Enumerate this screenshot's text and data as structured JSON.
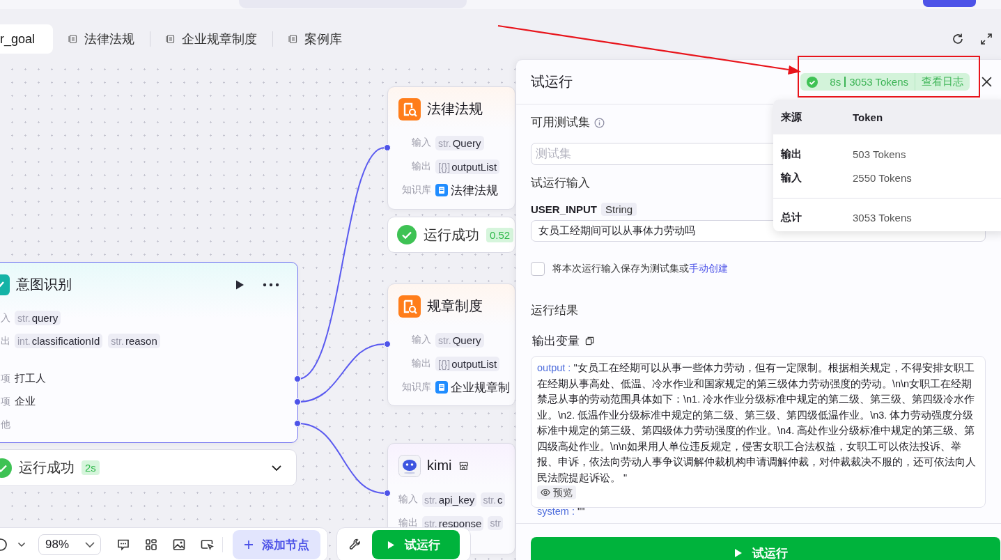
{
  "tabs": [
    {
      "label": "r_goal",
      "selected": true,
      "kind": "variable"
    },
    {
      "label": "法律法规",
      "selected": false,
      "kind": "doc"
    },
    {
      "label": "企业规章制度",
      "selected": false,
      "kind": "doc"
    },
    {
      "label": "案例库",
      "selected": false,
      "kind": "doc"
    }
  ],
  "canvas": {
    "nodes": [
      {
        "kind": "intent",
        "title": "意图识别",
        "rows": [
          {
            "label": "入",
            "chips": [
              {
                "type": "str.",
                "name": "query"
              }
            ]
          },
          {
            "label": "出",
            "chips": [
              {
                "type": "int.",
                "name": "classificationId"
              },
              {
                "type": "str.",
                "name": "reason"
              }
            ]
          }
        ],
        "options": [
          {
            "label": "项",
            "value": "打工人"
          },
          {
            "label": "项",
            "value": "企业"
          },
          {
            "label": "他"
          }
        ],
        "status": {
          "text": "运行成功",
          "time": "2s"
        }
      },
      {
        "kind": "knowledge",
        "title": "法律法规",
        "rows": [
          {
            "label": "输入",
            "chips": [
              {
                "type": "str.",
                "name": "Query"
              }
            ]
          },
          {
            "label": "输出",
            "chips": [
              {
                "type": "[{}]",
                "name": "outputList"
              }
            ]
          },
          {
            "label": "知识库",
            "kbs": [
              "法律法规"
            ]
          }
        ],
        "status": {
          "text": "运行成功",
          "time": "0.52"
        }
      },
      {
        "kind": "knowledge",
        "title": "规章制度",
        "rows": [
          {
            "label": "输入",
            "chips": [
              {
                "type": "str.",
                "name": "Query"
              }
            ]
          },
          {
            "label": "输出",
            "chips": [
              {
                "type": "[{}]",
                "name": "outputList"
              }
            ]
          },
          {
            "label": "知识库",
            "kbs": [
              "企业规章制"
            ]
          }
        ]
      },
      {
        "kind": "llm",
        "title": "kimi",
        "rows": [
          {
            "label": "输入",
            "chips": [
              {
                "type": "str.",
                "name": "api_key"
              },
              {
                "type": "str.",
                "name": "c"
              }
            ]
          },
          {
            "label": "输出",
            "chips": [
              {
                "type": "str.",
                "name": "response"
              },
              {
                "type": "str"
              }
            ]
          }
        ]
      }
    ],
    "toolbar": {
      "zoom": "98%",
      "add_node": "添加节点",
      "run": "试运行"
    }
  },
  "panel": {
    "title": "试运行",
    "summary": {
      "time": "8s",
      "tokens": "3053 Tokens",
      "log_link": "查看日志"
    },
    "test_set": {
      "label": "可用测试集",
      "placeholder": "测试集"
    },
    "input_section": "试运行输入",
    "variable": {
      "name": "USER_INPUT",
      "type": "String",
      "value": "女员工经期间可以从事体力劳动吗"
    },
    "save_option": {
      "checked": false,
      "text": "将本次运行输入保存为测试集或",
      "link": "手动创建"
    },
    "result_section": "运行结果",
    "output_heading": "输出变量",
    "outputs": [
      {
        "key": "output :",
        "value": "\"女员工在经期可以从事一些体力劳动，但有一定限制。根据相关规定，不得安排女职工在经期从事高处、低温、冷水作业和国家规定的第三级体力劳动强度的劳动。\\n\\n女职工在经期禁忌从事的劳动范围具体如下：\\n1. 冷水作业分级标准中规定的第二级、第三级、第四级冷水作业。\\n2. 低温作业分级标准中规定的第二级、第三级、第四级低温作业。\\n3. 体力劳动强度分级标准中规定的第三级、第四级体力劳动强度的作业。\\n4. 高处作业分级标准中规定的第三级、第四级高处作业。\\n\\n如果用人单位违反规定，侵害女职工合法权益，女职工可以依法投诉、举报、申诉，依法向劳动人事争议调解仲裁机构申请调解仲裁，对仲裁裁决不服的，还可依法向人民法院提起诉讼。 \"",
        "preview": "预览"
      },
      {
        "key": "system :",
        "value": "\"\""
      }
    ],
    "run_button": "试运行",
    "token_popover": {
      "columns": [
        "来源",
        "Token"
      ],
      "rows": [
        {
          "source": "输出",
          "tokens": "503 Tokens"
        },
        {
          "source": "输入",
          "tokens": "2550 Tokens"
        }
      ],
      "total": {
        "source": "总计",
        "tokens": "3053 Tokens"
      }
    }
  }
}
